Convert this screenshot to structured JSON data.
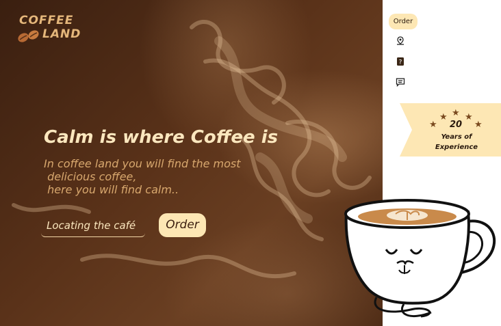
{
  "brand": {
    "line1": "COFFEE",
    "line2": "LAND",
    "beans_icon": "coffee-beans-icon"
  },
  "hero": {
    "headline": "Calm is where Coffee is",
    "subtext": "In coffee land you will find the most\n delicious coffee,\n here you will find calm..",
    "locate_label": "Locating the café",
    "order_label": "Order"
  },
  "nav": {
    "order_label": "Order",
    "icons": [
      "location-pin-icon",
      "question-icon",
      "message-icon"
    ]
  },
  "badge": {
    "number": "20",
    "text": "Years of\nExperience",
    "star_icon": "star-icon"
  },
  "illustration": {
    "name": "calm-coffee-cup-illustration"
  },
  "colors": {
    "hero_bg": "#5a3219",
    "accent": "#fde7b4",
    "headline": "#fbe7be",
    "sub": "#d8a86e"
  }
}
